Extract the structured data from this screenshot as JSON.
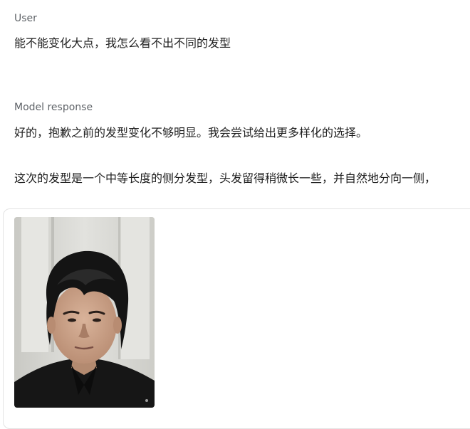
{
  "conversation": {
    "user": {
      "role_label": "User",
      "message": "能不能变化大点，我怎么看不出不同的发型"
    },
    "model": {
      "role_label": "Model response",
      "paragraphs": [
        "好的，抱歉之前的发型变化不够明显。我会尝试给出更多样化的选择。",
        "这次的发型是一个中等长度的侧分发型，头发留得稍微长一些，并自然地分向一侧，"
      ],
      "image": {
        "subject": "portrait photo of a man with medium-length dark wavy side-parted hair wearing a black shirt"
      }
    }
  },
  "colors": {
    "text": "#1f1f1f",
    "label": "#5f6368",
    "card_border": "#e3e3e3",
    "wall": "#d9d9d4"
  }
}
